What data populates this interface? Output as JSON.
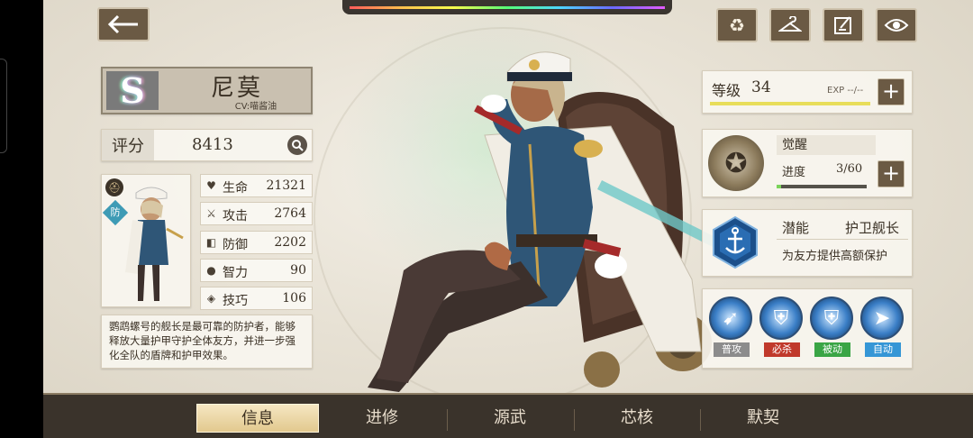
{
  "character": {
    "rank": "S",
    "name": "尼莫",
    "cv": "CV:喵酱油",
    "role": "防"
  },
  "score": {
    "label": "评分",
    "value": "8413"
  },
  "stats": [
    {
      "icon": "heart-icon",
      "label": "生命",
      "value": "21321"
    },
    {
      "icon": "sword-icon",
      "label": "攻击",
      "value": "2764"
    },
    {
      "icon": "shield-icon",
      "label": "防御",
      "value": "2202"
    },
    {
      "icon": "brain-icon",
      "label": "智力",
      "value": "90"
    },
    {
      "icon": "book-icon",
      "label": "技巧",
      "value": "106"
    }
  ],
  "description": "鹦鹉螺号的舰长是最可靠的防护者，能够释放大量护甲守护全体友方，并进一步强化全队的盾牌和护甲效果。",
  "level": {
    "label": "等级",
    "value": "34",
    "exp": "EXP --/--",
    "progress": 1.0
  },
  "awaken": {
    "title": "觉醒",
    "progress_label": "进度",
    "progress_value": "3/60",
    "progress": 0.05
  },
  "potential": {
    "label": "潜能",
    "name": "护卫舰长",
    "desc": "为友方提供高额保护"
  },
  "skills": [
    {
      "tag": "普攻",
      "icon": "normal-attack-icon"
    },
    {
      "tag": "必杀",
      "icon": "ultimate-icon"
    },
    {
      "tag": "被动",
      "icon": "passive-icon"
    },
    {
      "tag": "自动",
      "icon": "auto-icon"
    }
  ],
  "nav": {
    "tabs": [
      "信息",
      "进修",
      "源武",
      "芯核",
      "默契"
    ],
    "active": 0
  },
  "colors": {
    "button_bg": "#6b5a44",
    "nav_bg": "#3a332b",
    "active_tab": "#e2c98e",
    "ult_tag": "#c0392b",
    "passive_tag": "#3aa545",
    "auto_tag": "#3596d6"
  }
}
